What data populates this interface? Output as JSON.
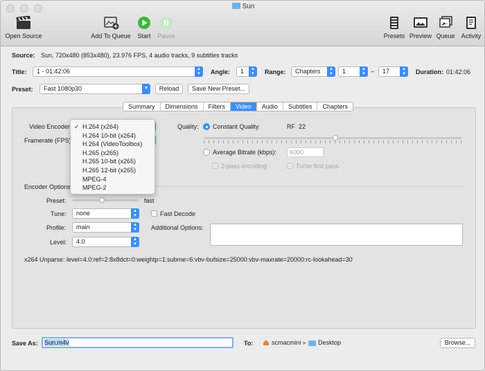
{
  "window": {
    "title": "Sun"
  },
  "toolbar": {
    "open_source": "Open Source",
    "add_to_queue": "Add To Queue",
    "start": "Start",
    "pause": "Pause",
    "presets": "Presets",
    "preview": "Preview",
    "queue": "Queue",
    "activity": "Activity"
  },
  "source": {
    "label": "Source:",
    "value": "Sun, 720x480 (853x480), 23.976 FPS, 4 audio tracks, 9 subtitles tracks"
  },
  "title_row": {
    "title_label": "Title:",
    "title_value": "1 - 01:42:06",
    "angle_label": "Angle:",
    "angle_value": "1",
    "range_label": "Range:",
    "range_type": "Chapters",
    "range_start": "1",
    "range_dash": "–",
    "range_end": "17",
    "duration_label": "Duration:",
    "duration_value": "01:42:06"
  },
  "preset_row": {
    "label": "Preset:",
    "value": "Fast 1080p30",
    "reload": "Reload",
    "save_new": "Save New Preset..."
  },
  "tabs": [
    "Summary",
    "Dimensions",
    "Filters",
    "Video",
    "Audio",
    "Subtitles",
    "Chapters"
  ],
  "selected_tab": "Video",
  "video": {
    "encoder_label": "Video Encoder",
    "framerate_label": "Framerate (FPS)",
    "quality_label": "Quality:",
    "constant_quality": "Constant Quality",
    "rf_label": "RF",
    "rf_value": "22",
    "rf_fraction": 0.51,
    "average_bitrate": "Average Bitrate (kbps):",
    "bitrate_value": "6000",
    "two_pass": "2-pass encoding",
    "turbo": "Turbo first pass"
  },
  "encoder_menu": {
    "items": [
      "H.264 (x264)",
      "H.264 10-bit (x264)",
      "H.264 (VideoToolbox)",
      "H.265 (x265)",
      "H.265 10-bit (x265)",
      "H.265 12-bit (x265)",
      "MPEG-4",
      "MPEG-2"
    ],
    "checkmark": "✓"
  },
  "encoder_options": {
    "section_label": "Encoder Options",
    "preset_label": "Preset:",
    "preset_value": "fast",
    "preset_fraction": 0.45,
    "tune_label": "Tune:",
    "tune_value": "none",
    "fast_decode": "Fast Decode",
    "profile_label": "Profile:",
    "profile_value": "main",
    "additional_label": "Additional Options:",
    "level_label": "Level:",
    "level_value": "4.0",
    "unparse": "x264 Unparse: level=4.0:ref=2:8x8dct=0:weightp=1:subme=6:vbv-bufsize=25000:vbv-maxrate=20000:rc-lookahead=30"
  },
  "save": {
    "label": "Save As:",
    "filename": "Sun.m4v",
    "to_label": "To:",
    "user": "scmacmini",
    "arrow": "▸",
    "folder": "Desktop",
    "browse": "Browse..."
  },
  "colors": {
    "accent": "#3d8ff3",
    "start_green": "#3fb53f"
  }
}
